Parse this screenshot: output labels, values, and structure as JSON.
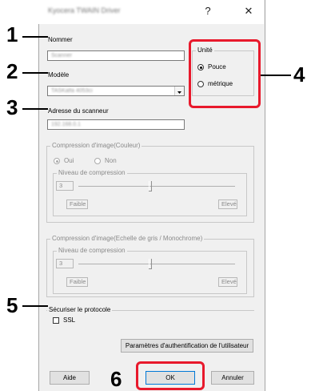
{
  "window": {
    "title": "Kyocera TWAIN Driver",
    "help_glyph": "?",
    "close_glyph": "✕"
  },
  "fields": {
    "name": {
      "label": "Nommer",
      "value": "Scanner"
    },
    "model": {
      "label": "Modèle",
      "value": "TASKalfa 4053ci"
    },
    "scanner_address": {
      "label": "Adresse du scanneur",
      "value": "192.168.0.1"
    }
  },
  "unit": {
    "title": "Unité",
    "options": [
      "Pouce",
      "métrique"
    ],
    "selected": "Pouce"
  },
  "color_compression": {
    "title": "Compression d'image(Couleur)",
    "yes": "Oui",
    "no": "Non",
    "selected": "Oui",
    "level_title": "Niveau de compression",
    "level_value": "3",
    "low_label": "Faible",
    "high_label": "Elevé",
    "level_fraction": 0.45
  },
  "gray_compression": {
    "title": "Compression d'image(Echelle de gris / Monochrome)",
    "level_title": "Niveau de compression",
    "level_value": "3",
    "low_label": "Faible",
    "high_label": "Elevé",
    "level_fraction": 0.45
  },
  "protocol": {
    "title": "Sécuriser le protocole",
    "ssl_label": "SSL",
    "ssl_checked": false
  },
  "buttons": {
    "auth": "Paramètres d'authentification de l'utilisateur",
    "help": "Aide",
    "ok": "OK",
    "cancel": "Annuler"
  },
  "callouts": [
    "1",
    "2",
    "3",
    "4",
    "5",
    "6"
  ],
  "colors": {
    "highlight": "#e8192c"
  }
}
